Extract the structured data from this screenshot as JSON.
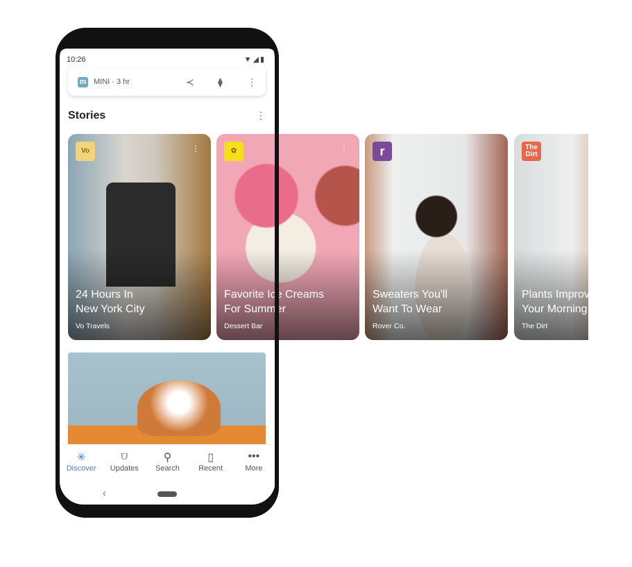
{
  "status": {
    "time": "10:26",
    "icons": "wifi-signal-battery"
  },
  "mini_bar": {
    "logo": "m",
    "label": "MINI · 3 hr"
  },
  "stories": {
    "title": "Stories"
  },
  "cards": [
    {
      "logo": "Vo",
      "title": "24 Hours In\nNew York City",
      "source": "Vo Travels",
      "logo_color": "#f5d37a"
    },
    {
      "logo": "",
      "title": "Favorite Ice Creams\nFor Summer",
      "source": "Dessert Bar",
      "logo_color": "#f7e017"
    },
    {
      "logo": "r",
      "title": "Sweaters You'll\nWant To Wear",
      "source": "Rover Co.",
      "logo_color": "#7b4a9c"
    },
    {
      "logo": "The Dirt",
      "title": "Plants Improve\nYour Morning",
      "source": "The Dirt",
      "logo_color": "#e8664a"
    }
  ],
  "nav": [
    {
      "label": "Discover",
      "icon": "asterisk"
    },
    {
      "label": "Updates",
      "icon": "updates"
    },
    {
      "label": "Search",
      "icon": "search"
    },
    {
      "label": "Recent",
      "icon": "recent"
    },
    {
      "label": "More",
      "icon": "more"
    }
  ],
  "colors": {
    "accent": "#4a7fe0"
  }
}
